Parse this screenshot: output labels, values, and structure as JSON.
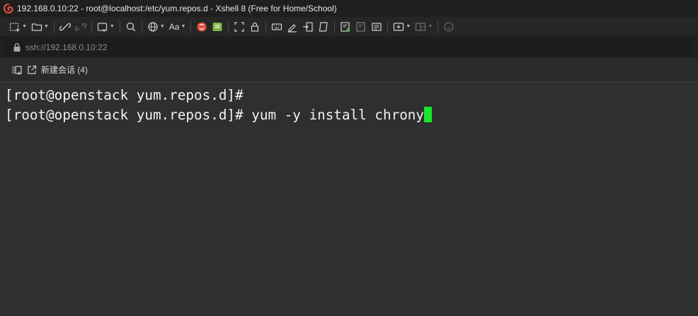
{
  "window": {
    "title": "192.168.0.10:22 - root@localhost:/etc/yum.repos.d - Xshell 8 (Free for Home/School)",
    "app_icon": "xshell-logo-icon",
    "accent_color": "#e44c3a"
  },
  "toolbar": {
    "font_label": "Aa",
    "icons": [
      "new-session-icon",
      "open-folder-icon",
      "connect-icon",
      "disconnect-icon",
      "new-tab-icon",
      "find-icon",
      "globe-icon",
      "font-icon",
      "xshell-icon",
      "xftp-icon",
      "fullscreen-icon",
      "lock-icon",
      "keyboard-icon",
      "highlight-icon",
      "transfer-icon",
      "script-icon",
      "compose-icon",
      "log-icon",
      "notes-icon",
      "add-tab-icon",
      "layout-icon",
      "help-icon"
    ]
  },
  "address_bar": {
    "url": "ssh://192.168.0.10:22"
  },
  "session_bar": {
    "new_session_label": "新建会话 (4)"
  },
  "terminal": {
    "lines": [
      "[root@openstack yum.repos.d]#",
      "[root@openstack yum.repos.d]# yum -y install chrony"
    ],
    "cursor_color": "#17e62a",
    "text_color": "#f2f2f2",
    "background": "#2f2f2f"
  }
}
